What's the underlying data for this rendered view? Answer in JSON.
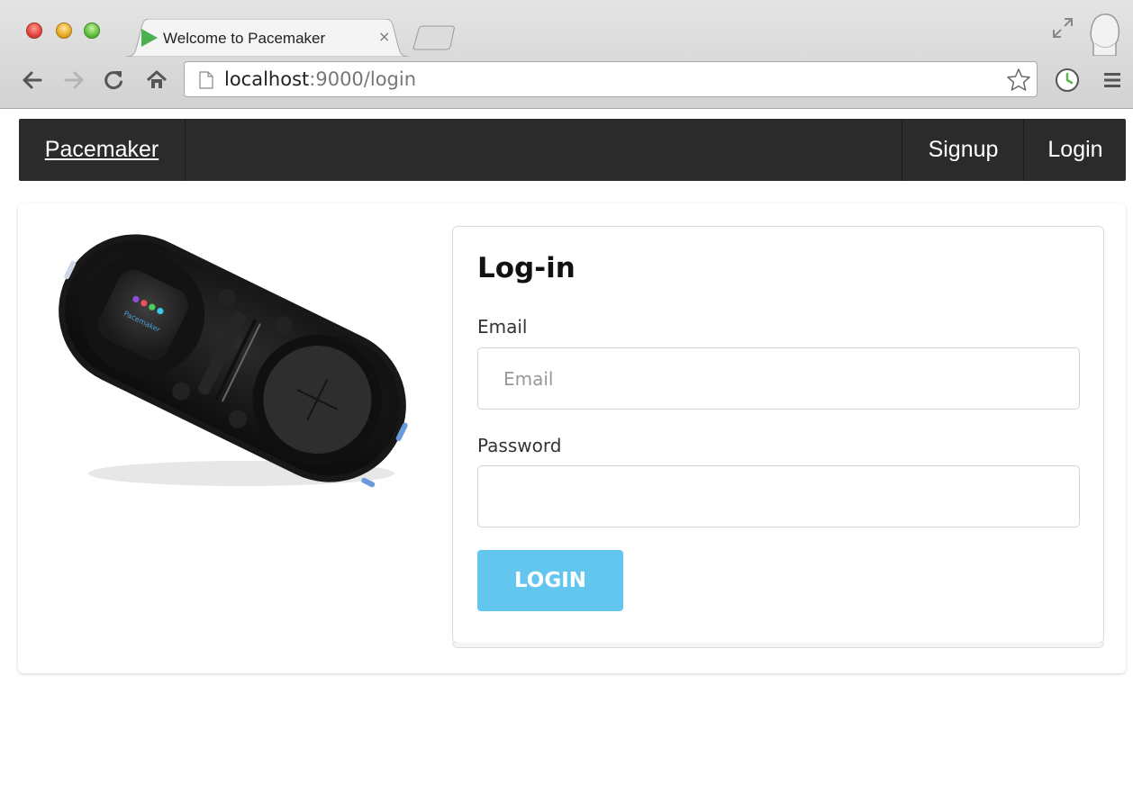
{
  "browser": {
    "tab": {
      "title": "Welcome to Pacemaker",
      "close_glyph": "×",
      "favicon": "play-triangle-icon"
    },
    "address": {
      "host": "localhost",
      "rest": ":9000/login"
    },
    "colors": {
      "tab_favicon": "#4caf50",
      "history_icon": "#5bb84a"
    }
  },
  "navbar": {
    "brand": "Pacemaker",
    "links": [
      {
        "label": "Signup"
      },
      {
        "label": "Login"
      }
    ],
    "background": "#2b2b2b"
  },
  "hero": {
    "device_image": "pacemaker-dj-device",
    "device_label": "Pacemaker"
  },
  "login_form": {
    "title": "Log-in",
    "email": {
      "label": "Email",
      "placeholder": "Email",
      "value": ""
    },
    "password": {
      "label": "Password",
      "value": ""
    },
    "submit_label": "LOGIN",
    "button_color": "#62c6ef"
  }
}
